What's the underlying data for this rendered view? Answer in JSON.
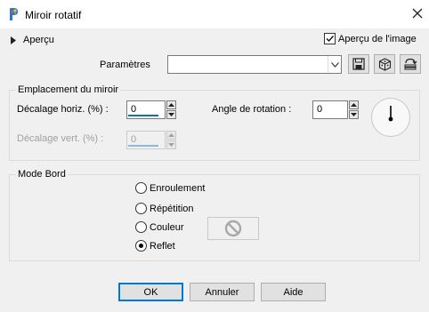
{
  "window": {
    "title": "Miroir rotatif"
  },
  "preview": {
    "toggle_label": "Aperçu",
    "checkbox_label": "Aperçu de l'image",
    "checked": true
  },
  "presets": {
    "label": "Paramètres",
    "value": ""
  },
  "mirror_location": {
    "title": "Emplacement du miroir",
    "horiz_label": "Décalage horiz. (%) :",
    "horiz_value": "0",
    "vert_label": "Décalage vert. (%) :",
    "vert_value": "0",
    "angle_label": "Angle de rotation :",
    "angle_value": "0"
  },
  "edge_mode": {
    "title": "Mode Bord",
    "options": [
      {
        "label": "Enroulement",
        "checked": false
      },
      {
        "label": "Répétition",
        "checked": false
      },
      {
        "label": "Couleur",
        "checked": false
      },
      {
        "label": "Reflet",
        "checked": true
      }
    ]
  },
  "buttons": {
    "ok": "OK",
    "cancel": "Annuler",
    "help": "Aide"
  },
  "icons": {
    "app": "psp-app-icon",
    "close": "close-icon",
    "expand": "triangle-right-icon",
    "save": "save-disk-icon",
    "random": "dice-icon",
    "reset": "reset-default-icon",
    "dial": "rotation-dial-icon",
    "no_color": "no-symbol-icon"
  },
  "colors": {
    "accent": "#0078d7",
    "field_underline": "#0a6fc2"
  }
}
